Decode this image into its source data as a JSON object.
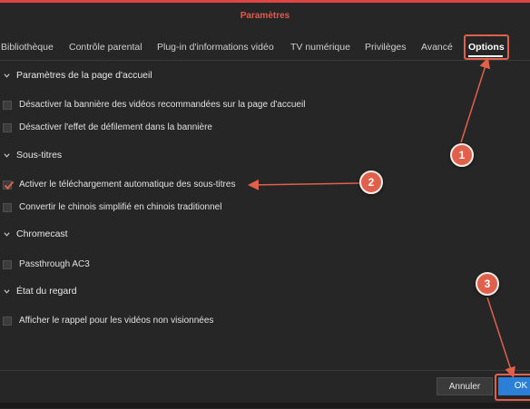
{
  "window": {
    "title": "Paramètres"
  },
  "tabs": [
    {
      "label": "Bibliothèque"
    },
    {
      "label": "Contrôle parental"
    },
    {
      "label": "Plug-in d'informations vidéo"
    },
    {
      "label": "TV numérique"
    },
    {
      "label": "Privilèges"
    },
    {
      "label": "Avancé"
    },
    {
      "label": "Options",
      "active": true
    }
  ],
  "sections": {
    "home": {
      "title": "Paramètres de la page d'accueil",
      "options": [
        {
          "label": "Désactiver la bannière des vidéos recommandées sur la page d'accueil",
          "checked": false
        },
        {
          "label": "Désactiver l'effet de défilement dans la bannière",
          "checked": false
        }
      ]
    },
    "subtitles": {
      "title": "Sous-titres",
      "options": [
        {
          "label": "Activer le téléchargement automatique des sous-titres",
          "checked": true
        },
        {
          "label": "Convertir le chinois simplifié en chinois traditionnel",
          "checked": false
        }
      ]
    },
    "chromecast": {
      "title": "Chromecast",
      "options": [
        {
          "label": "Passthrough AC3",
          "checked": false
        }
      ]
    },
    "watch": {
      "title": "État du regard",
      "options": [
        {
          "label": "Afficher le rappel pour les vidéos non visionnées",
          "checked": false
        }
      ]
    }
  },
  "buttons": {
    "cancel": "Annuler",
    "ok": "OK"
  },
  "annotations": {
    "step1": "1",
    "step2": "2",
    "step3": "3"
  },
  "colors": {
    "accent": "#e0604b",
    "ok_button": "#2c7fd6",
    "background": "#262626"
  }
}
